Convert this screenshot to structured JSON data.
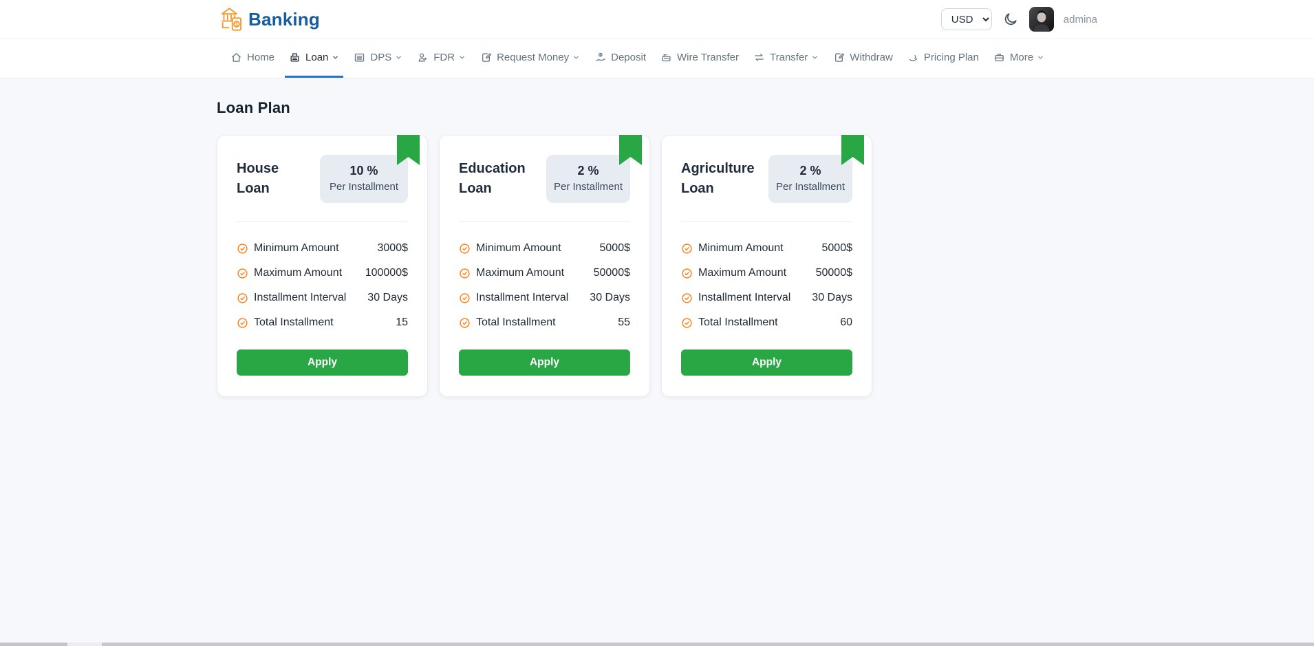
{
  "brand": {
    "name": "Banking",
    "logo_icon": "bank-with-phone-icon"
  },
  "header": {
    "currency_selected": "USD",
    "theme_icon": "moon-icon",
    "username": "admina"
  },
  "nav": {
    "items": [
      {
        "label": "Home",
        "icon": "home-icon",
        "has_dropdown": false,
        "active": false
      },
      {
        "label": "Loan",
        "icon": "loan-icon",
        "has_dropdown": true,
        "active": true
      },
      {
        "label": "DPS",
        "icon": "dps-icon",
        "has_dropdown": true,
        "active": false
      },
      {
        "label": "FDR",
        "icon": "fdr-icon",
        "has_dropdown": true,
        "active": false
      },
      {
        "label": "Request Money",
        "icon": "request-money-icon",
        "has_dropdown": true,
        "active": false
      },
      {
        "label": "Deposit",
        "icon": "deposit-icon",
        "has_dropdown": false,
        "active": false
      },
      {
        "label": "Wire Transfer",
        "icon": "wire-transfer-icon",
        "has_dropdown": false,
        "active": false
      },
      {
        "label": "Transfer",
        "icon": "transfer-icon",
        "has_dropdown": true,
        "active": false
      },
      {
        "label": "Withdraw",
        "icon": "withdraw-icon",
        "has_dropdown": false,
        "active": false
      },
      {
        "label": "Pricing Plan",
        "icon": "pricing-plan-icon",
        "has_dropdown": false,
        "active": false
      },
      {
        "label": "More",
        "icon": "more-icon",
        "has_dropdown": true,
        "active": false
      }
    ]
  },
  "page": {
    "title": "Loan Plan"
  },
  "cards": [
    {
      "title": "House Loan",
      "rate": "10 %",
      "rate_period": "Per Installment",
      "rows": [
        {
          "label": "Minimum Amount",
          "value": "3000$"
        },
        {
          "label": "Maximum Amount",
          "value": "100000$"
        },
        {
          "label": "Installment Interval",
          "value": "30 Days"
        },
        {
          "label": "Total Installment",
          "value": "15"
        }
      ],
      "apply_label": "Apply"
    },
    {
      "title": "Education Loan",
      "rate": "2 %",
      "rate_period": "Per Installment",
      "rows": [
        {
          "label": "Minimum Amount",
          "value": "5000$"
        },
        {
          "label": "Maximum Amount",
          "value": "50000$"
        },
        {
          "label": "Installment Interval",
          "value": "30 Days"
        },
        {
          "label": "Total Installment",
          "value": "55"
        }
      ],
      "apply_label": "Apply"
    },
    {
      "title": "Agriculture Loan",
      "rate": "2 %",
      "rate_period": "Per Installment",
      "rows": [
        {
          "label": "Minimum Amount",
          "value": "5000$"
        },
        {
          "label": "Maximum Amount",
          "value": "50000$"
        },
        {
          "label": "Installment Interval",
          "value": "30 Days"
        },
        {
          "label": "Total Installment",
          "value": "60"
        }
      ],
      "apply_label": "Apply"
    }
  ],
  "colors": {
    "accent_green": "#2aa745",
    "accent_orange": "#fd7e14",
    "brand_blue": "#155c9e",
    "active_tab_underline": "#2a70c2",
    "badge_bg": "#e7ecf3",
    "page_bg": "#f7f8fb"
  }
}
